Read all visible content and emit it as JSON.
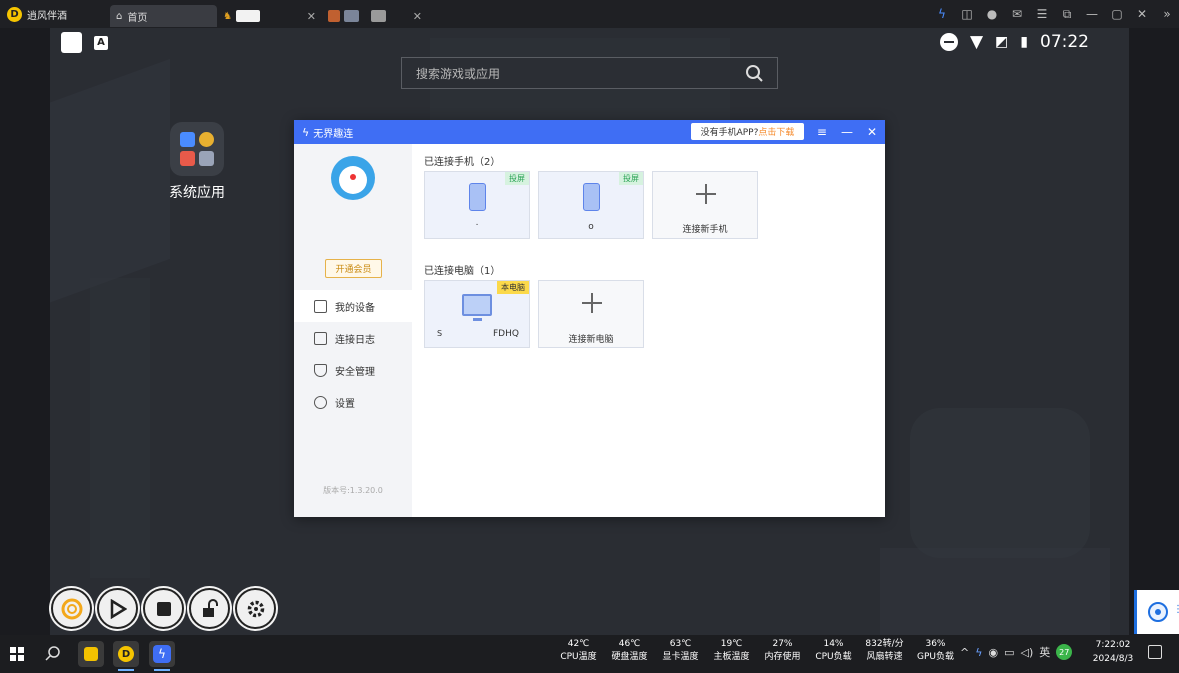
{
  "tabbar": {
    "app_name": "逍风伴酒",
    "tabs": [
      {
        "label": "首页",
        "active": true
      },
      {
        "label": "",
        "active": false
      },
      {
        "label": "",
        "active": false
      }
    ],
    "tools": [
      "bolt-icon",
      "gamepad-icon",
      "user-icon",
      "mail-icon",
      "menu-icon",
      "restore-icon",
      "minimize-icon",
      "maximize-icon",
      "close-icon",
      "chevron-double-icon"
    ]
  },
  "android": {
    "time": "07:22",
    "search_placeholder": "搜索游戏或应用",
    "folder_label": "系统应用"
  },
  "dialog": {
    "title": "无界趣连",
    "download_text": "没有手机APP?",
    "download_link": "点击下载",
    "vip_button": "开通会员",
    "nav": [
      {
        "label": "我的设备",
        "icon": "devices-icon",
        "active": true
      },
      {
        "label": "连接日志",
        "icon": "log-icon",
        "active": false
      },
      {
        "label": "安全管理",
        "icon": "shield-icon",
        "active": false
      },
      {
        "label": "设置",
        "icon": "settings-icon",
        "active": false
      }
    ],
    "version": "版本号:1.3.20.0",
    "phones_title": "已连接手机（2）",
    "phones": [
      {
        "badge": "投屏",
        "caption": "."
      },
      {
        "badge": "投屏",
        "caption": "o"
      }
    ],
    "add_phone": "连接新手机",
    "pcs_title": "已连接电脑（1）",
    "pcs": [
      {
        "badge": "本电脑",
        "caption_left": "S",
        "caption_right": "FDHQ"
      }
    ],
    "add_pc": "连接新电脑"
  },
  "taskbar": {
    "metrics": [
      {
        "value": "42℃",
        "label": "CPU温度"
      },
      {
        "value": "46℃",
        "label": "硬盘温度"
      },
      {
        "value": "63℃",
        "label": "显卡温度"
      },
      {
        "value": "19℃",
        "label": "主板温度"
      },
      {
        "value": "27%",
        "label": "内存使用"
      },
      {
        "value": "14%",
        "label": "CPU负载"
      },
      {
        "value": "832转/分",
        "label": "风扇转速"
      },
      {
        "value": "36%",
        "label": "GPU负载"
      }
    ],
    "ime": "英",
    "badge_num": "27",
    "clock_time": "7:22:02",
    "clock_date": "2024/8/3"
  },
  "colors": {
    "accent": "#3f6ef4",
    "vip": "#e6b24a",
    "badge_green": "#27a152",
    "badge_yellow": "#fbd94a"
  }
}
